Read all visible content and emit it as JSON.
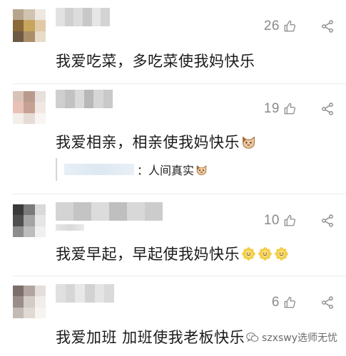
{
  "comments": [
    {
      "id": "c1",
      "text": "我爱吃菜，多吃菜使我妈快乐",
      "likes": "26",
      "emoji_count": 0,
      "avatar_colors": [
        "#b7a48f",
        "#d2c3b1",
        "#efe8e0",
        "#8a6a3a",
        "#c8a55c",
        "#e2c9a8",
        "#6c5a44",
        "#ab8e6a",
        "#e8dcc8"
      ],
      "name_colors": [
        "#e2e2e2",
        "#d0d0d0",
        "#dcdcdc",
        "#c8c8c8",
        "#e6e6e6",
        "#d4d4d4"
      ]
    },
    {
      "id": "c2",
      "text": "我爱相亲，相亲使我妈快乐",
      "likes": "19",
      "emoji_count": 1,
      "avatar_colors": [
        "#d9c2b8",
        "#b99b8e",
        "#e7e0dc",
        "#eac2b5",
        "#c6a094",
        "#f2e8e3",
        "#f3efea",
        "#e6dcd6",
        "#f8f4f2"
      ],
      "name_colors": [
        "#cfcfcf",
        "#c2c2c2",
        "#dadada",
        "#b8b8b8",
        "#d6d6d6",
        "#c9c9c9"
      ],
      "quote": {
        "text": "：人间真实",
        "emoji_count": 1
      }
    },
    {
      "id": "c3",
      "text": "我爱早起，早起使我妈快乐",
      "likes": "10",
      "emoji_count": 3,
      "avatar_colors": [
        "#3a3a3a",
        "#7a7a7a",
        "#d9d9d9",
        "#4f4f4f",
        "#a4a4a4",
        "#e6e6e6",
        "#8d8d8d",
        "#bdbdbd",
        "#f0f0f0"
      ],
      "name_colors": [
        "#d4d4d4",
        "#c4c4c4",
        "#dcdcdc",
        "#bfbfbf",
        "#d8d8d8",
        "#cccccc"
      ]
    },
    {
      "id": "c4",
      "text": "我爱加班 加班使我老板快乐",
      "likes": "6",
      "emoji_count": 0,
      "avatar_colors": [
        "#7d6f6a",
        "#b1a6a1",
        "#e4dfdc",
        "#9b8e88",
        "#d3cbc6",
        "#f1ede9",
        "#c4bab4",
        "#e0d9d4",
        "#f6f3f0"
      ],
      "name_colors": [
        "#e0e0e0",
        "#d6d6d6",
        "#e8e8e8",
        "#d2d2d2",
        "#e4e4e4",
        "#dadada"
      ]
    }
  ],
  "watermark": {
    "text": "szxswy选师无忧"
  },
  "icons": {
    "like": "thumb-up-icon",
    "share": "share-icon",
    "emoji": "cat-face-emoji",
    "emoji_alt": "flower-smile-emoji"
  }
}
